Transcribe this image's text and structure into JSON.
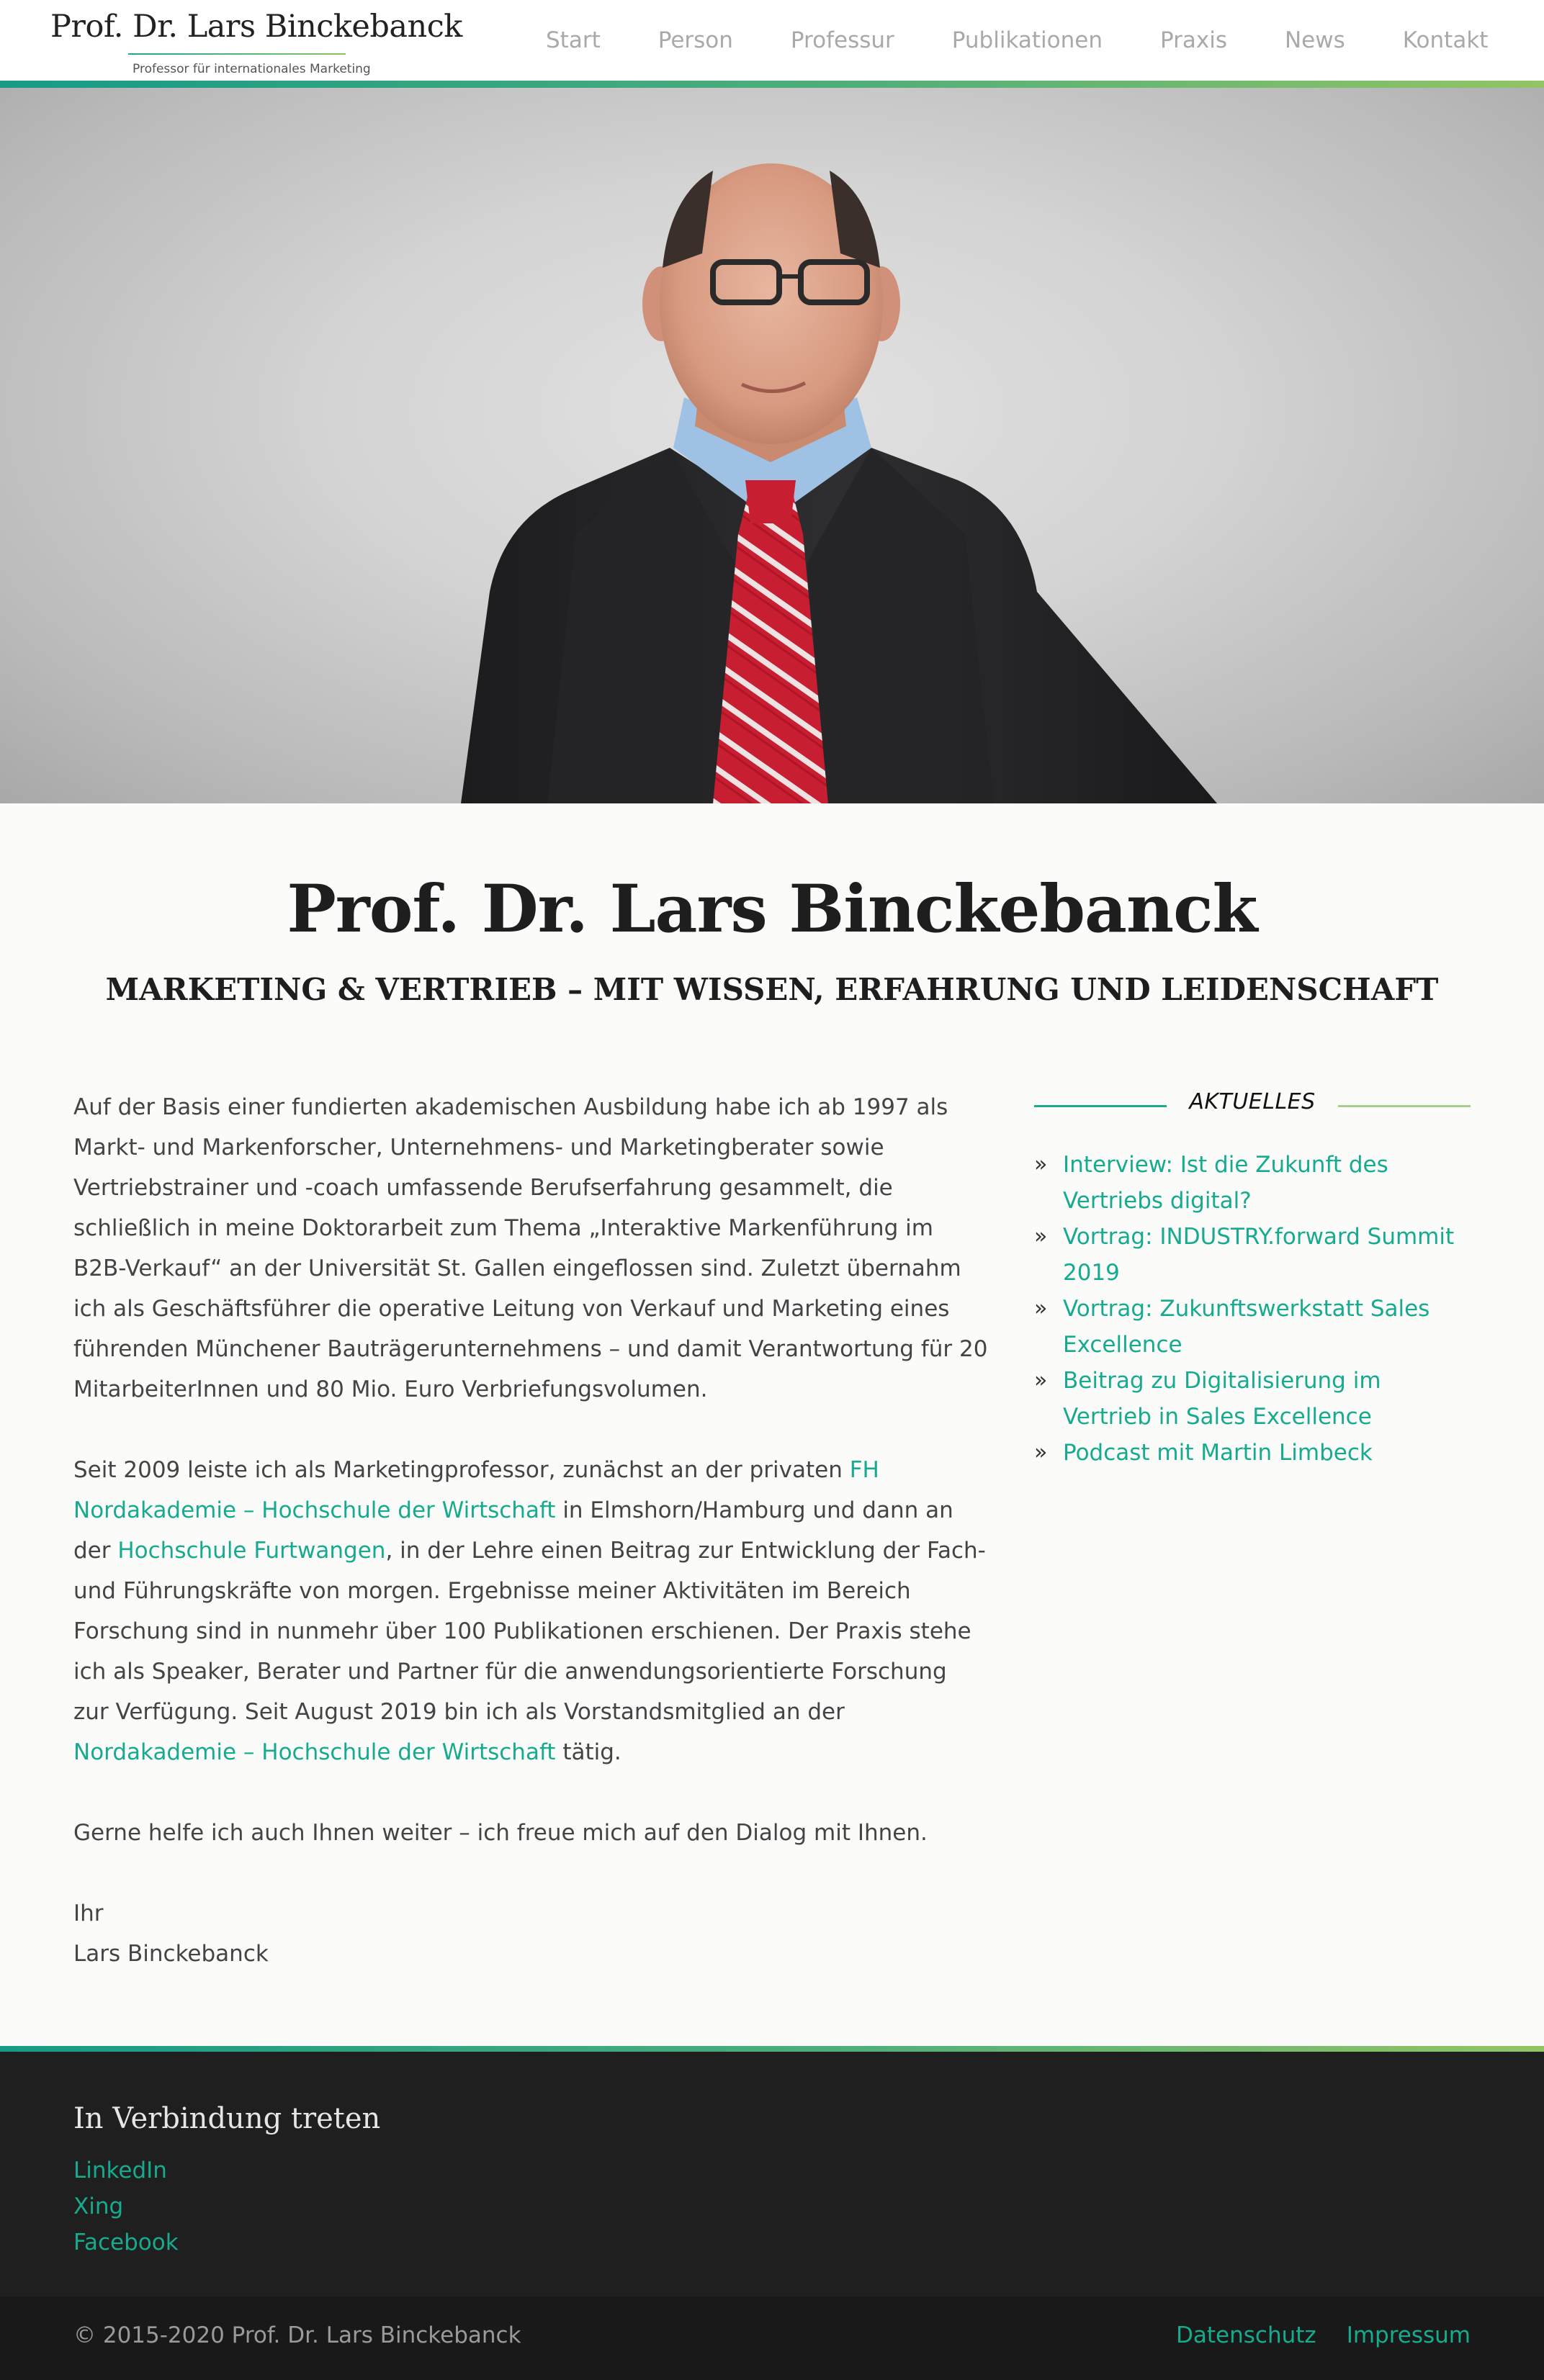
{
  "header": {
    "brand_name": "Prof. Dr. Lars Binckebanck",
    "brand_tagline": "Professor für internationales Marketing",
    "nav": [
      "Start",
      "Person",
      "Professur",
      "Publikationen",
      "Praxis",
      "News",
      "Kontakt"
    ]
  },
  "intro": {
    "title": "Prof. Dr. Lars Binckebanck",
    "subtitle": "MARKETING & VERTRIEB – MIT WISSEN, ERFAHRUNG UND LEIDENSCHAFT"
  },
  "main": {
    "p1": "Auf der Basis einer fundierten akademischen Ausbildung habe ich ab 1997 als Markt- und Markenforscher, Unternehmens- und Marketingberater sowie Vertriebstrainer und -coach umfassende Berufserfahrung gesammelt, die schließlich in meine Doktorarbeit zum Thema „Interaktive Markenführung im B2B-Verkauf“ an der Universität St. Gallen eingeflossen sind. Zuletzt übernahm ich als Geschäftsführer die operative Leitung von Verkauf und Marketing eines führenden Münchener Bauträgerunternehmens – und damit Verantwortung für 20 MitarbeiterInnen und 80 Mio. Euro Verbriefungsvolumen.",
    "p2_a": "Seit 2009 leiste ich als Marketingprofessor, zunächst an der privaten ",
    "p2_link1": "FH Nordakademie – Hochschule der Wirtschaft",
    "p2_b": " in Elmshorn/Hamburg und dann an der ",
    "p2_link2": "Hochschule Furtwangen",
    "p2_c": ", in der Lehre einen Beitrag zur Entwicklung der Fach- und Führungskräfte von morgen. Ergebnisse meiner Aktivitäten im Bereich Forschung sind in nunmehr über 100 Publikationen erschienen. Der Praxis stehe ich als Speaker, Berater und Partner für die anwendungsorientierte Forschung zur Verfügung. Seit August 2019 bin ich als Vorstandsmitglied an der ",
    "p2_link3": "Nordakademie – Hochschule der Wirtschaft",
    "p2_d": " tätig.",
    "p3": "Gerne helfe ich auch Ihnen weiter – ich freue mich auf den Dialog mit Ihnen.",
    "closing": "Ihr",
    "signature": "Lars Binckebanck"
  },
  "sidebar": {
    "title": "AKTUELLES",
    "bullet": "»",
    "items": [
      "Interview: Ist die Zukunft des Vertriebs digital?",
      "Vortrag: INDUSTRY.forward Summit 2019",
      "Vortrag: Zukunftswerkstatt Sales Excellence",
      "Beitrag zu Digitalisierung im Vertrieb in Sales Excellence",
      "Podcast mit Martin Limbeck"
    ]
  },
  "footer": {
    "heading": "In Verbindung treten",
    "links": [
      "LinkedIn",
      "Xing",
      "Facebook"
    ],
    "copyright": "© 2015-2020 Prof. Dr. Lars Binckebanck",
    "legal": [
      "Datenschutz",
      "Impressum"
    ]
  },
  "colors": {
    "accent": "#16ab8e",
    "accent_green": "#92c464",
    "footer_bg": "#1f1f1f"
  }
}
